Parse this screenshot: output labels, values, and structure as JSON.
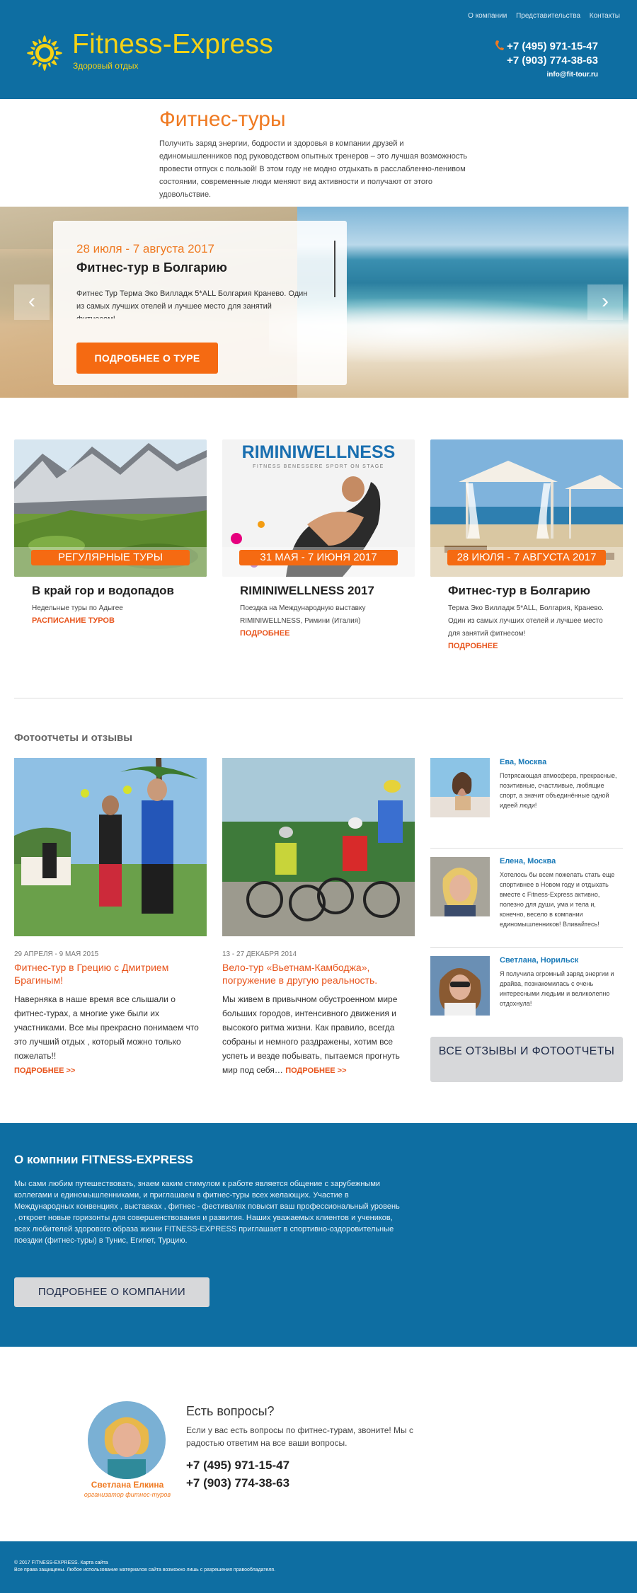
{
  "header": {
    "nav": [
      "О компании",
      "Представительства",
      "Контакты"
    ],
    "logo_title": "Fitness-Express",
    "logo_subtitle": "Здоровый отдых",
    "phone1": "+7 (495) 971-15-47",
    "phone2": "+7 (903) 774-38-63",
    "email": "info@fit-tour.ru",
    "accent": "#0e6ea2",
    "logo_color": "#f5d216"
  },
  "intro": {
    "title": "Фитнес-туры",
    "text": "Получить заряд энергии, бодрости и здоровья в компании друзей и единомышленников под руководством опытных тренеров – это лучшая возможность провести отпуск с пользой! В этом году не модно отдыхать в расслабленно-ленивом состоянии, современные люди меняют вид активности и получают от этого удовольствие."
  },
  "slider": {
    "date": "28 июля - 7 августа 2017",
    "title": "Фитнес-тур в Болгарию",
    "text": "Фитнес Тур Терма Эко Вилладж 5*ALL Болгария Кранево. Один из самых лучших отелей и лучшее место для занятий фитнесом!",
    "button": "ПОДРОБНЕЕ О ТУРЕ",
    "prev_icon": "‹",
    "next_icon": "›"
  },
  "tours": [
    {
      "badge": "РЕГУЛЯРНЫЕ ТУРЫ",
      "title": "В край гор и водопадов",
      "desc": "Недельные туры по Адыгее",
      "link": "РАСПИСАНИЕ ТУРОВ"
    },
    {
      "badge": "31 МАЯ - 7 ИЮНЯ 2017",
      "title": "RIMINIWELLNESS 2017",
      "desc": "Поездка на Международную выставку RIMINIWELLNESS, Римини (Италия)",
      "link": "ПОДРОБНЕЕ",
      "img_title": "RIMINIWELLNESS",
      "img_sub": "FITNESS BENESSERE SPORT ON STAGE"
    },
    {
      "badge": "28 ИЮЛЯ - 7 АВГУСТА 2017",
      "title": "Фитнес-тур в Болгарию",
      "desc": "Терма Эко Вилладж 5*ALL, Болгария, Кранево. Один из самых лучших отелей и лучшее место для занятий фитнесом!",
      "link": "ПОДРОБНЕЕ"
    }
  ],
  "reports": {
    "title": "Фотоотчеты и отзывы",
    "items": [
      {
        "date": "29 АПРЕЛЯ - 9 МАЯ 2015",
        "title": "Фитнес-тур в Грецию с Дмитрием Брагиным!",
        "text": "Наверняка в наше время все слышали о фитнес-турах, а многие уже были их участниками. Все мы прекрасно понимаем что это лучший отдых , который можно только пожелать!!",
        "more": "ПОДРОБНЕЕ >>"
      },
      {
        "date": "13 - 27 ДЕКАБРЯ 2014",
        "title": "Вело-тур «Вьетнам-Камбоджа», погружение в другую реальность.",
        "text": "Мы живем в привычном обустроенном мире больших городов, интенсивного движения и высокого ритма жизни. Как правило, всегда собраны и немного раздражены, хотим все успеть и везде побывать, пытаемся прогнуть мир под себя…",
        "more": "ПОДРОБНЕЕ >>"
      }
    ],
    "reviews": [
      {
        "name": "Ева, Москва",
        "text": "Потрясающая атмосфера, прекрасные, позитивные, счастливые, любящие спорт, а значит объединённые одной идеей люди!"
      },
      {
        "name": "Елена, Москва",
        "text": "Хотелось бы всем пожелать стать еще спортивнее в Новом году и отдыхать вместе с Fitness-Express активно, полезно для души, ума и тела и, конечно, весело в компании единомышленников! Вливайтесь!"
      },
      {
        "name": "Светлана, Норильск",
        "text": "Я получила огромный заряд энергии и драйва, познакомилась с очень интересными людьми и великолепно отдохнула!"
      }
    ],
    "all_button": "ВСЕ ОТЗЫВЫ И ФОТООТЧЕТЫ"
  },
  "about": {
    "title": "О компнии FITNESS-EXPRESS",
    "text": "Мы сами любим путешествовать, знаем каким стимулом к работе является общение с зарубежными коллегами и единомышленниками, и приглашаем в фитнес-туры всех желающих. Участие в Международных конвенциях , выставках , фитнес - фестивалях повысит ваш профессиональный уровень , откроет новые горизонты для совершенствования и развития. Наших уважаемых клиентов и учеников, всех любителей здорового образа жизни FITNESS-EXPRESS приглашает в спортивно-оздоровительные поездки (фитнес-туры) в Тунис, Египет, Турцию.",
    "button": "ПОДРОБНЕЕ О КОМПАНИИ"
  },
  "questions": {
    "name": "Светлана Елкина",
    "role": "организатор фитнес-туров",
    "title": "Есть вопросы?",
    "text": "Если у вас есть вопросы по фитнес-турам, звоните! Мы с радостью ответим на все ваши вопросы.",
    "phone1": "+7 (495) 971-15-47",
    "phone2": "+7 (903) 774-38-63"
  },
  "footer": {
    "line1": "© 2017 FITNESS-EXPRESS. Карта сайта",
    "line2": "Все права защищены. Любое использование материалов сайта возможно лишь с разрешения правообладателя."
  }
}
